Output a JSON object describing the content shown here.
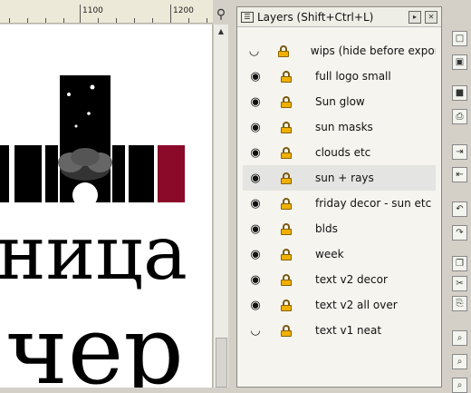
{
  "ruler": {
    "labels": [
      "1100",
      "1200"
    ]
  },
  "panel": {
    "title": "Layers (Shift+Ctrl+L)",
    "buttons": [
      "panel-menu",
      "panel-close"
    ]
  },
  "layers": [
    {
      "name": "wips (hide before exporting)",
      "visible": false
    },
    {
      "name": "full logo small",
      "visible": true
    },
    {
      "name": "Sun glow",
      "visible": true
    },
    {
      "name": "sun masks",
      "visible": true
    },
    {
      "name": "clouds etc",
      "visible": true
    },
    {
      "name": "sun + rays",
      "visible": true,
      "selected": true
    },
    {
      "name": "friday decor - sun etc",
      "visible": true
    },
    {
      "name": "blds",
      "visible": true
    },
    {
      "name": "week",
      "visible": true
    },
    {
      "name": "text v2 decor",
      "visible": true
    },
    {
      "name": "text v2 all over",
      "visible": true
    },
    {
      "name": "text v1 neat",
      "visible": false
    }
  ],
  "canvas": {
    "text_line1": "ница",
    "text_line2": "чер",
    "accent_color": "#8b0a2a"
  },
  "toolbar_icons": [
    "new-doc-icon",
    "open-icon",
    "save-icon",
    "print-icon",
    "import-icon",
    "export-icon",
    "undo-icon",
    "redo-icon",
    "copy-icon",
    "cut-icon",
    "paste-icon",
    "zoom-selection-icon",
    "zoom-drawing-icon",
    "zoom-page-icon"
  ]
}
